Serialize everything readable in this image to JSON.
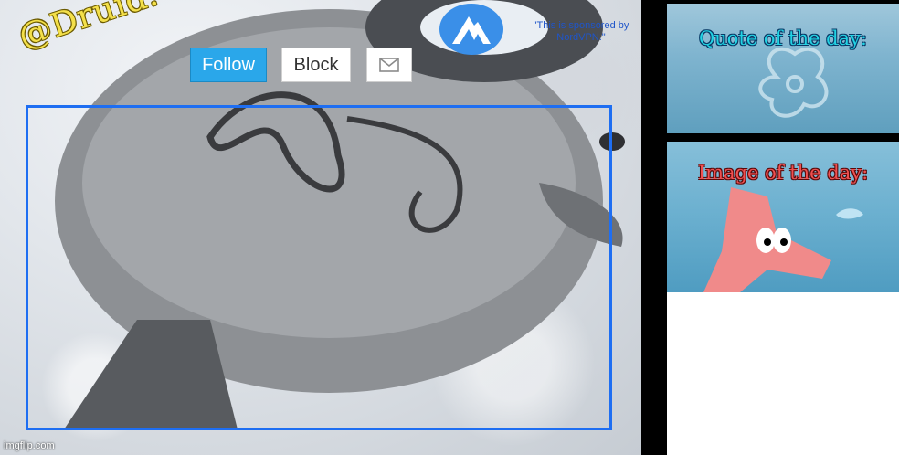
{
  "profile": {
    "handle": "@Druid."
  },
  "actions": {
    "follow_label": "Follow",
    "block_label": "Block",
    "message_icon": "mail-icon"
  },
  "sponsor": {
    "text": "\"This is sponsored by NordVPN.\"",
    "logo_icon": "nordvpn-mountain-icon"
  },
  "sidebar": {
    "quote_title": "Quote of the day:",
    "image_title": "Image of the day:"
  },
  "watermark": {
    "text": "imgflip.com"
  },
  "colors": {
    "follow_bg": "#2aa7ea",
    "frame_border": "#1e6ef2",
    "handle_text": "#f4e04a",
    "quote_title": "#22d3e4",
    "image_title": "#f05050",
    "sponsor_text": "#1f55c9"
  }
}
